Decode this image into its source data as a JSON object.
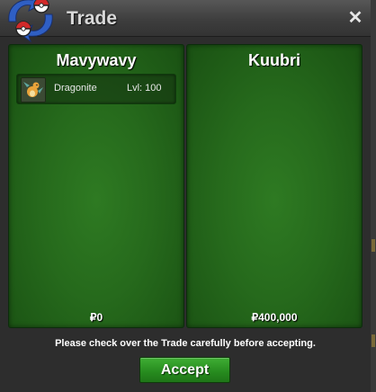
{
  "window": {
    "title": "Trade",
    "close_label": "✕"
  },
  "left_panel": {
    "trainer_name": "Mavywavy",
    "pokemon": [
      {
        "name": "Dragonite",
        "level": "Lvl: 100"
      }
    ],
    "money": "₽0"
  },
  "right_panel": {
    "trainer_name": "Kuubri",
    "money": "₽400,000"
  },
  "footer": {
    "notice": "Please check over the Trade carefully before accepting.",
    "accept_label": "Accept"
  },
  "colors": {
    "panel_green": "#266a1c",
    "button_green": "#268a1e",
    "window_bg": "#2d2d2d"
  }
}
